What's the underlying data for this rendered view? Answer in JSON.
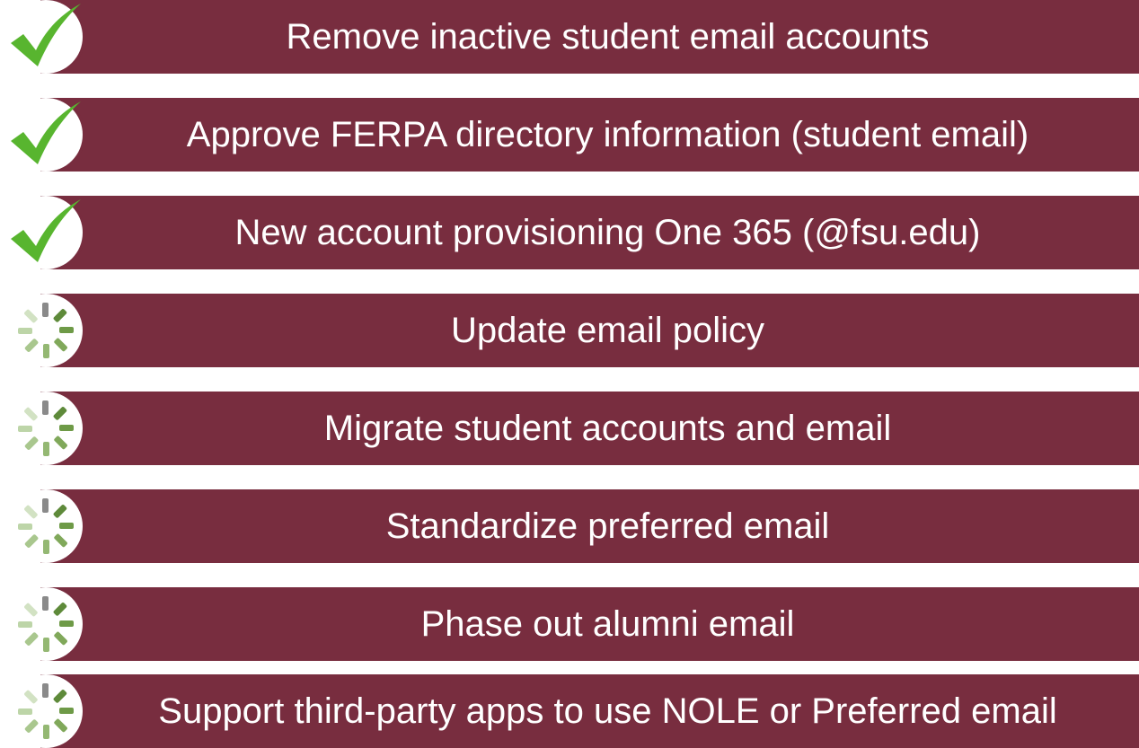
{
  "colors": {
    "bar": "#782d3f",
    "check": "#58b52f",
    "spinner": "#6a8f3d"
  },
  "tasks": [
    {
      "label": "Remove inactive student email accounts",
      "status_icon": "checkmark-icon"
    },
    {
      "label": "Approve FERPA directory information (student email)",
      "status_icon": "checkmark-icon"
    },
    {
      "label": "New account provisioning One 365 (@fsu.edu)",
      "status_icon": "checkmark-icon"
    },
    {
      "label": "Update email policy",
      "status_icon": "loading-spinner-icon"
    },
    {
      "label": "Migrate student accounts and email",
      "status_icon": "loading-spinner-icon"
    },
    {
      "label": "Standardize preferred email",
      "status_icon": "loading-spinner-icon"
    },
    {
      "label": "Phase out alumni email",
      "status_icon": "loading-spinner-icon"
    },
    {
      "label": "Support third-party apps to use NOLE or Preferred email",
      "status_icon": "loading-spinner-icon"
    }
  ]
}
